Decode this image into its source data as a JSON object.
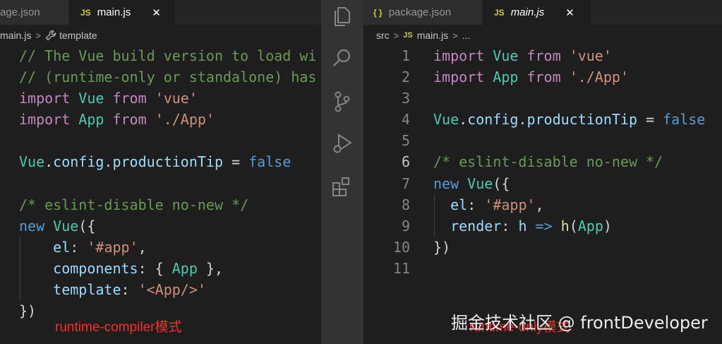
{
  "left": {
    "tabs": [
      {
        "label": "age.json",
        "icon": "{ }"
      },
      {
        "label": "main.js",
        "icon": "JS",
        "close": "✕"
      }
    ],
    "breadcrumb": [
      "main.js",
      "template"
    ],
    "code": [
      [
        [
          "c-cmt",
          "// The Vue build version to load wi"
        ]
      ],
      [
        [
          "c-cmt",
          "// (runtime-only or standalone) has"
        ]
      ],
      [
        [
          "c-kw",
          "import"
        ],
        [
          "c-punc",
          " "
        ],
        [
          "c-id",
          "Vue"
        ],
        [
          "c-punc",
          " "
        ],
        [
          "c-kw",
          "from"
        ],
        [
          "c-punc",
          " "
        ],
        [
          "c-str",
          "'vue'"
        ]
      ],
      [
        [
          "c-kw",
          "import"
        ],
        [
          "c-punc",
          " "
        ],
        [
          "c-id",
          "App"
        ],
        [
          "c-punc",
          " "
        ],
        [
          "c-kw",
          "from"
        ],
        [
          "c-punc",
          " "
        ],
        [
          "c-str",
          "'./App'"
        ]
      ],
      [],
      [
        [
          "c-id",
          "Vue"
        ],
        [
          "c-punc",
          "."
        ],
        [
          "c-prop",
          "config"
        ],
        [
          "c-punc",
          "."
        ],
        [
          "c-prop",
          "productionTip"
        ],
        [
          "c-punc",
          " = "
        ],
        [
          "c-bool",
          "false"
        ]
      ],
      [],
      [
        [
          "c-cmt",
          "/* eslint-disable no-new */"
        ]
      ],
      [
        [
          "c-bool",
          "new"
        ],
        [
          "c-punc",
          " "
        ],
        [
          "c-id",
          "Vue"
        ],
        [
          "c-punc",
          "({"
        ]
      ],
      [
        [
          "c-punc",
          "    "
        ],
        [
          "c-prop",
          "el"
        ],
        [
          "c-punc",
          ": "
        ],
        [
          "c-str",
          "'#app'"
        ],
        [
          "c-punc",
          ","
        ]
      ],
      [
        [
          "c-punc",
          "    "
        ],
        [
          "c-prop",
          "components"
        ],
        [
          "c-punc",
          ": { "
        ],
        [
          "c-id",
          "App"
        ],
        [
          "c-punc",
          " },"
        ]
      ],
      [
        [
          "c-punc",
          "    "
        ],
        [
          "c-prop",
          "template"
        ],
        [
          "c-punc",
          ": "
        ],
        [
          "c-str",
          "'<App/>'"
        ]
      ],
      [
        [
          "c-punc",
          "})"
        ]
      ]
    ],
    "note": "runtime-compiler模式"
  },
  "right": {
    "tabs": [
      {
        "label": "package.json",
        "icon": "{ }"
      },
      {
        "label": "main.js",
        "icon": "JS",
        "close": "✕"
      }
    ],
    "breadcrumb": [
      "src",
      "main.js",
      "..."
    ],
    "line_numbers": [
      "1",
      "2",
      "3",
      "4",
      "5",
      "6",
      "7",
      "8",
      "9",
      "10",
      "11"
    ],
    "current_line": 6,
    "code": [
      [
        [
          "c-kw",
          "import"
        ],
        [
          "c-punc",
          " "
        ],
        [
          "c-id",
          "Vue"
        ],
        [
          "c-punc",
          " "
        ],
        [
          "c-kw",
          "from"
        ],
        [
          "c-punc",
          " "
        ],
        [
          "c-str",
          "'vue'"
        ]
      ],
      [
        [
          "c-kw",
          "import"
        ],
        [
          "c-punc",
          " "
        ],
        [
          "c-id",
          "App"
        ],
        [
          "c-punc",
          " "
        ],
        [
          "c-kw",
          "from"
        ],
        [
          "c-punc",
          " "
        ],
        [
          "c-str",
          "'./App'"
        ]
      ],
      [],
      [
        [
          "c-id",
          "Vue"
        ],
        [
          "c-punc",
          "."
        ],
        [
          "c-prop",
          "config"
        ],
        [
          "c-punc",
          "."
        ],
        [
          "c-prop",
          "productionTip"
        ],
        [
          "c-punc",
          " = "
        ],
        [
          "c-bool",
          "false"
        ]
      ],
      [],
      [
        [
          "c-cmt",
          "/* eslint-disable no-new */"
        ]
      ],
      [
        [
          "c-bool",
          "new"
        ],
        [
          "c-punc",
          " "
        ],
        [
          "c-id",
          "Vue"
        ],
        [
          "c-punc",
          "({"
        ]
      ],
      [
        [
          "c-punc",
          "  "
        ],
        [
          "c-prop",
          "el"
        ],
        [
          "c-punc",
          ": "
        ],
        [
          "c-str",
          "'#app'"
        ],
        [
          "c-punc",
          ","
        ]
      ],
      [
        [
          "c-punc",
          "  "
        ],
        [
          "c-prop",
          "render"
        ],
        [
          "c-punc",
          ": "
        ],
        [
          "c-prop",
          "h"
        ],
        [
          "c-punc",
          " "
        ],
        [
          "c-bool",
          "=>"
        ],
        [
          "c-punc",
          " "
        ],
        [
          "c-fn",
          "h"
        ],
        [
          "c-punc",
          "("
        ],
        [
          "c-id",
          "App"
        ],
        [
          "c-punc",
          ")"
        ]
      ],
      [
        [
          "c-punc",
          "})"
        ]
      ],
      []
    ],
    "note": "runtime-only模式"
  },
  "activity_bar": [
    "files-icon",
    "search-icon",
    "source-control-icon",
    "run-debug-icon",
    "extensions-icon"
  ],
  "watermark": "掘金技术社区 @ frontDeveloper",
  "colors": {
    "editor_bg": "#1e1e1e",
    "keyword": "#c586c0",
    "class": "#4ec9b0",
    "string": "#ce9178",
    "comment": "#6a9955",
    "note": "#ff2a2a"
  }
}
